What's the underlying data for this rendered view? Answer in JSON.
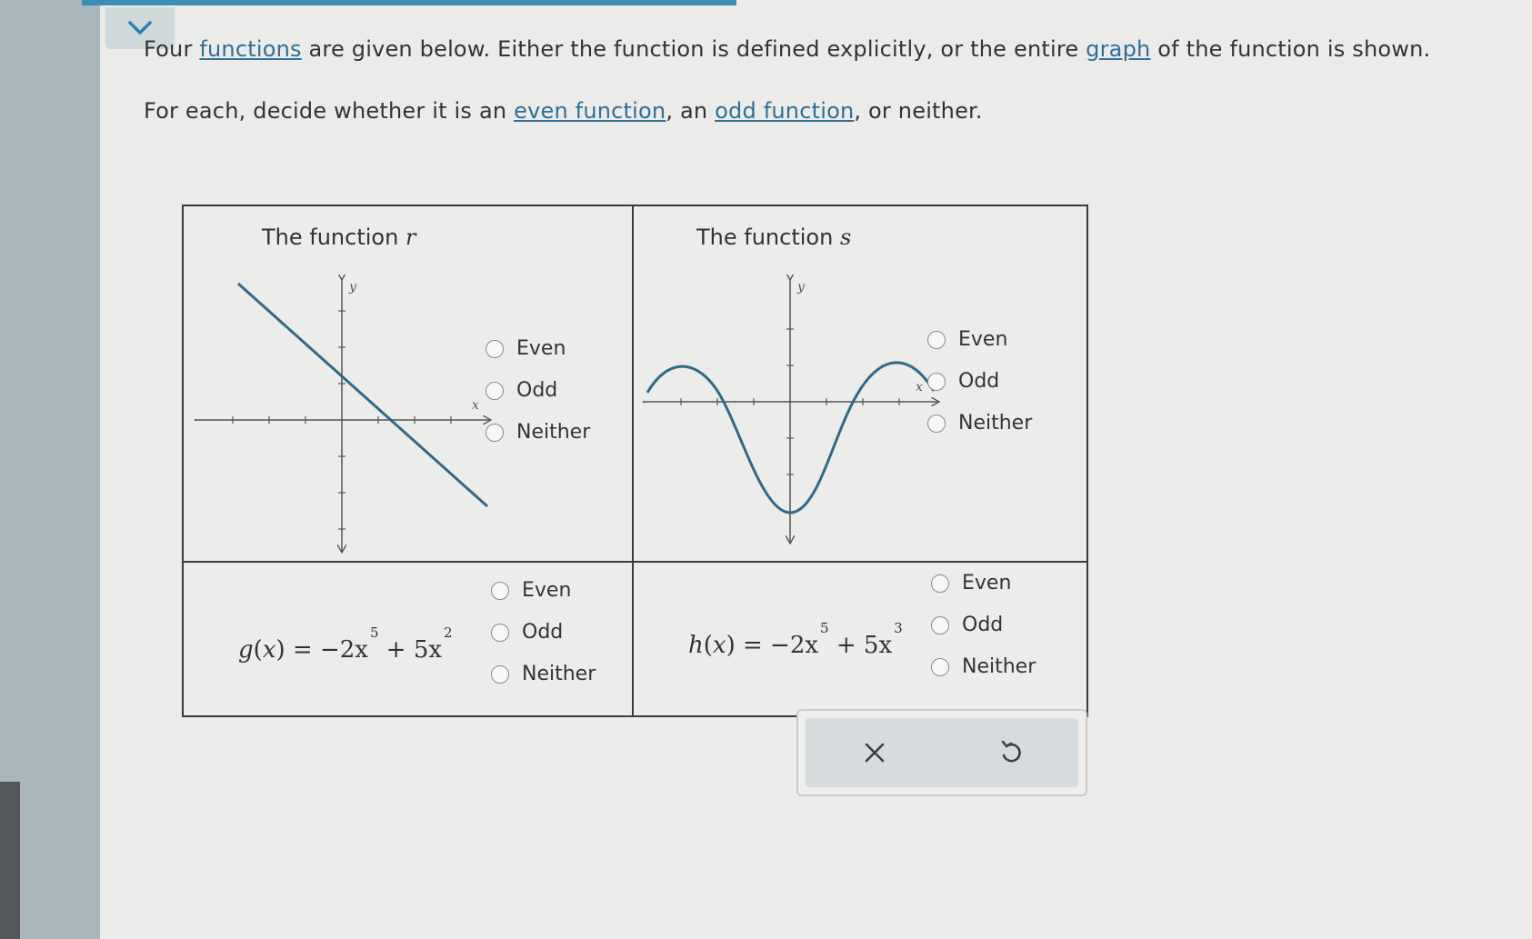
{
  "prompt": {
    "line1": {
      "t1": "Four ",
      "link_functions": "functions",
      "t2": " are given below. Either the function is defined explicitly, or the entire ",
      "link_graph": "graph",
      "t3": " of the function is shown."
    },
    "line2": {
      "t1": "For each, decide whether it is an ",
      "link_even": "even function",
      "t2": ", an ",
      "link_odd": "odd function",
      "t3": ", or neither."
    }
  },
  "cells": {
    "r": {
      "title": "The function ",
      "var": "r"
    },
    "s": {
      "title": "The function ",
      "var": "s"
    },
    "g": {
      "name": "g",
      "arg": "x",
      "eq": "= −2x",
      "exp1": "5",
      "plus": "+ 5x",
      "exp2": "2"
    },
    "h": {
      "name": "h",
      "arg": "x",
      "eq": "= −2x",
      "exp1": "5",
      "plus": "+ 5x",
      "exp2": "3"
    }
  },
  "axis_labels": {
    "x": "x",
    "y": "y"
  },
  "options": {
    "even": "Even",
    "odd": "Odd",
    "neither": "Neither"
  },
  "actions": {
    "clear_icon": "x-icon",
    "undo_icon": "undo-icon"
  },
  "colors": {
    "curve": "#2f6a86",
    "link": "#2f6f98"
  }
}
